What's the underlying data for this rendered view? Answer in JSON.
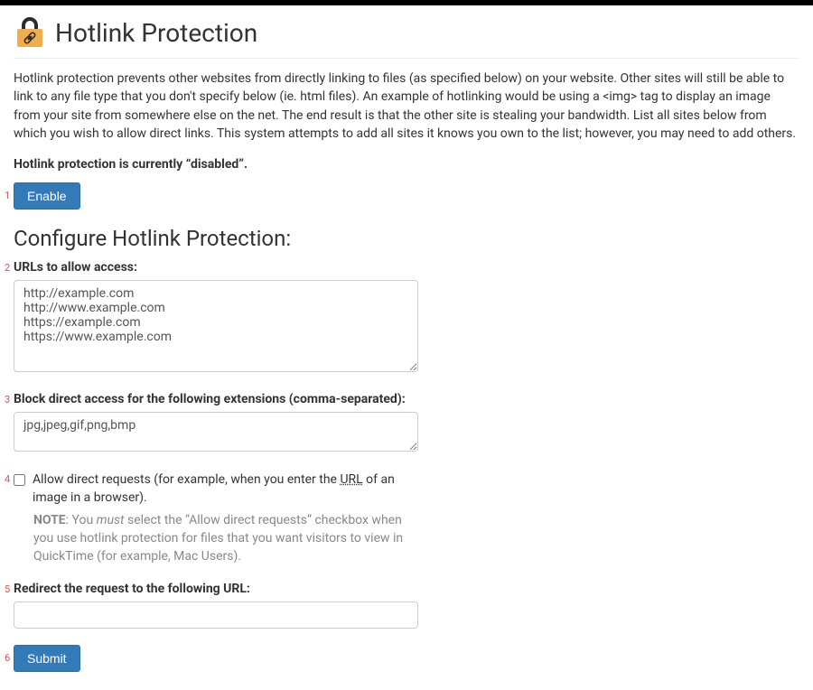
{
  "header": {
    "title": "Hotlink Protection",
    "icon_name": "lock-link-icon"
  },
  "description": "Hotlink protection prevents other websites from directly linking to files (as specified below) on your website. Other sites will still be able to link to any file type that you don't specify below (ie. html files). An example of hotlinking would be using a <img> tag to display an image from your site from somewhere else on the net. The end result is that the other site is stealing your bandwidth. List all sites below from which you wish to allow direct links. This system attempts to add all sites it knows you own to the list; however, you may need to add others.",
  "status": {
    "prefix": "Hotlink protection is currently ",
    "value": "“disabled”",
    "suffix": "."
  },
  "enable_button": "Enable",
  "section_title": "Configure Hotlink Protection:",
  "urls": {
    "label": "URLs to allow access:",
    "value": "http://example.com\nhttp://www.example.com\nhttps://example.com\nhttps://www.example.com"
  },
  "extensions": {
    "label": "Block direct access for the following extensions (comma-separated):",
    "value": "jpg,jpeg,gif,png,bmp"
  },
  "allow_direct": {
    "label_pre": "Allow direct requests (for example, when you enter the ",
    "label_abbr": "URL",
    "label_post": " of an image in a browser).",
    "note_label": "NOTE",
    "note_sep": ": You ",
    "note_emph": "must",
    "note_rest": " select the “Allow direct requests” checkbox when you use hotlink protection for files that you want visitors to view in QuickTime (for example, Mac Users)."
  },
  "redirect": {
    "label": "Redirect the request to the following URL:",
    "value": ""
  },
  "submit_button": "Submit",
  "markers": {
    "m1": "1",
    "m2": "2",
    "m3": "3",
    "m4": "4",
    "m5": "5",
    "m6": "6"
  }
}
